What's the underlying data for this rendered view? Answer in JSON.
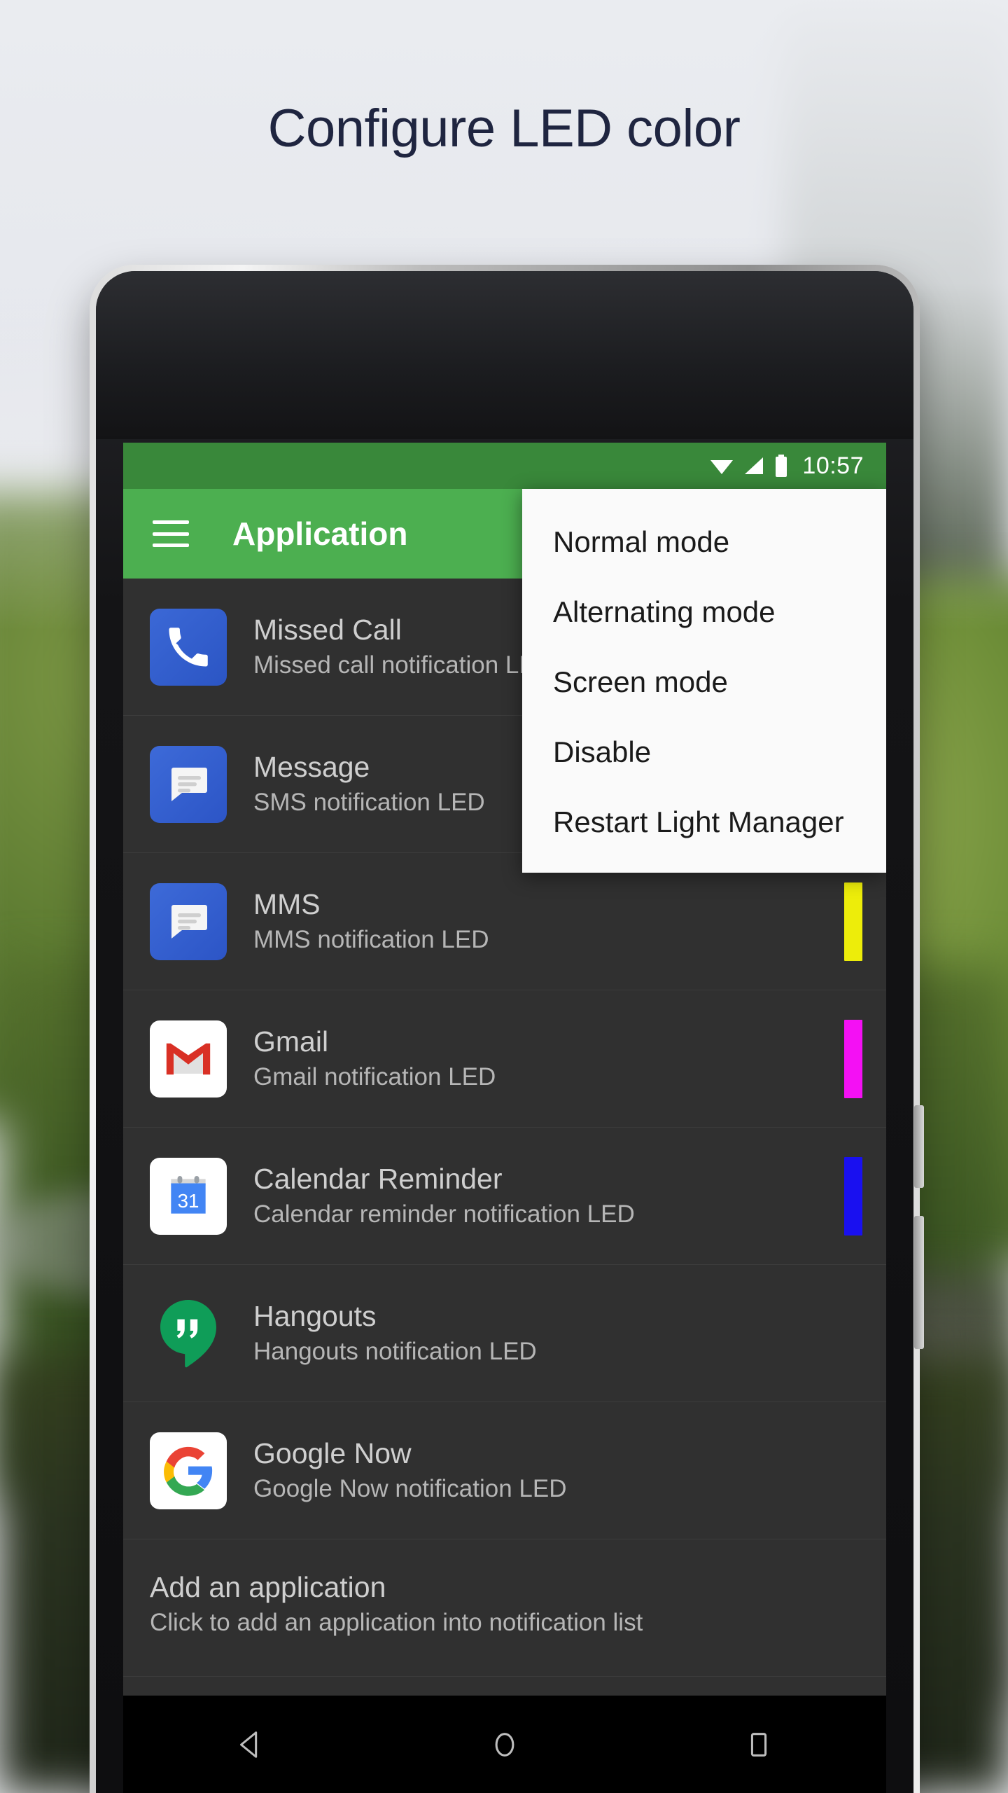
{
  "headline": "Configure LED color",
  "statusbar": {
    "time": "10:57",
    "icons": [
      "wifi-icon",
      "signal-icon",
      "battery-icon"
    ],
    "bg_color": "#39883a"
  },
  "appbar": {
    "title": "Application",
    "menu_icon": "hamburger-icon",
    "bg_color": "#4caf50"
  },
  "overflow_menu": {
    "items": [
      {
        "label": "Normal mode"
      },
      {
        "label": "Alternating mode"
      },
      {
        "label": "Screen mode"
      },
      {
        "label": "Disable"
      },
      {
        "label": "Restart Light Manager"
      }
    ]
  },
  "list": {
    "rows": [
      {
        "title": "Missed Call",
        "subtitle": "Missed call notification LED",
        "icon": "phone-icon",
        "led_color": ""
      },
      {
        "title": "Message",
        "subtitle": "SMS notification LED",
        "icon": "message-icon",
        "led_color": ""
      },
      {
        "title": "MMS",
        "subtitle": "MMS notification LED",
        "icon": "message-icon",
        "led_color": "#eded0a"
      },
      {
        "title": "Gmail",
        "subtitle": "Gmail notification LED",
        "icon": "gmail-icon",
        "led_color": "#f410f4"
      },
      {
        "title": "Calendar Reminder",
        "subtitle": "Calendar reminder notification LED",
        "icon": "calendar-icon",
        "led_color": "#1910f0"
      },
      {
        "title": "Hangouts",
        "subtitle": "Hangouts notification LED",
        "icon": "hangouts-icon",
        "led_color": ""
      },
      {
        "title": "Google Now",
        "subtitle": "Google Now notification LED",
        "icon": "google-icon",
        "led_color": ""
      }
    ],
    "add_row": {
      "title": "Add an application",
      "subtitle": "Click to add an application into notification list"
    }
  },
  "navbar": {
    "buttons": [
      "back-icon",
      "home-icon",
      "recents-icon"
    ]
  },
  "colors": {
    "headline_text": "#1f2540",
    "list_bg": "#303030",
    "row_title": "#cfcfcf",
    "row_sub": "#b6b6b6"
  }
}
